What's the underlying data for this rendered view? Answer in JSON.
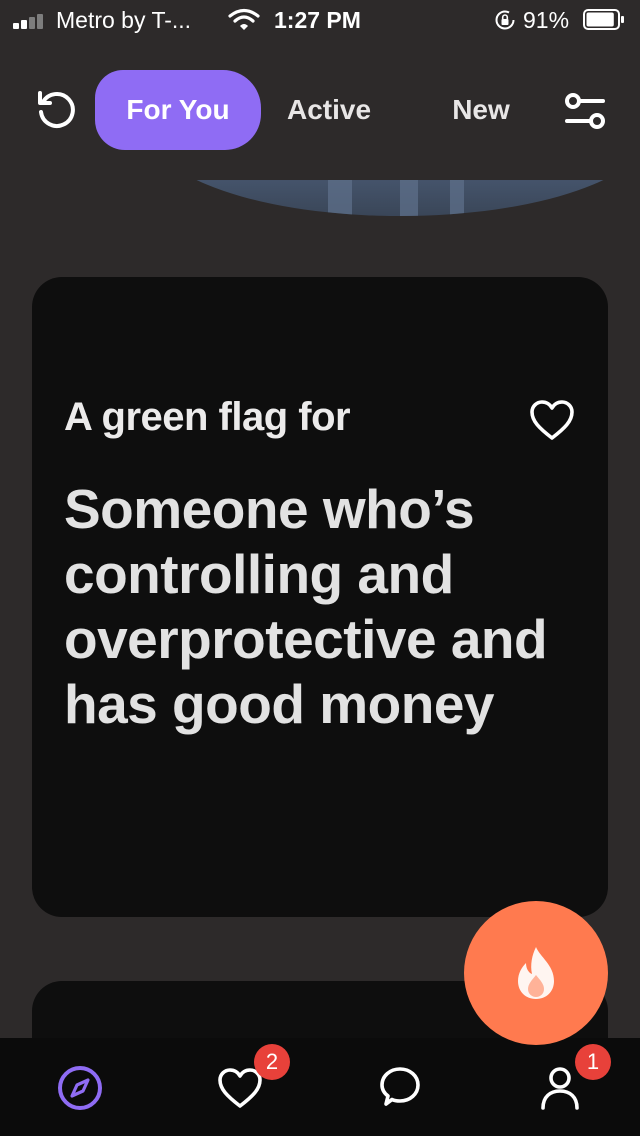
{
  "status_bar": {
    "carrier": "Metro by T-...",
    "time": "1:27 PM",
    "battery_percent": "91%",
    "signal_bars": 2,
    "battery_level": 0.91
  },
  "top_nav": {
    "tabs": [
      {
        "label": "For You",
        "active": true
      },
      {
        "label": "Active",
        "active": false
      },
      {
        "label": "New",
        "active": false
      }
    ],
    "accent_color": "#8f6cf4"
  },
  "card": {
    "prompt": "A green flag for",
    "answer": "Someone who’s controlling and overprotective and has good money"
  },
  "fab": {
    "icon": "flame-icon",
    "color": "#ff7a4f"
  },
  "bottom_nav": {
    "items": [
      {
        "icon": "compass-icon",
        "active": true
      },
      {
        "icon": "heart-icon",
        "badge": "2"
      },
      {
        "icon": "chat-bubble-icon"
      },
      {
        "icon": "user-icon",
        "badge": "1"
      }
    ],
    "badge_color": "#e8413a"
  }
}
